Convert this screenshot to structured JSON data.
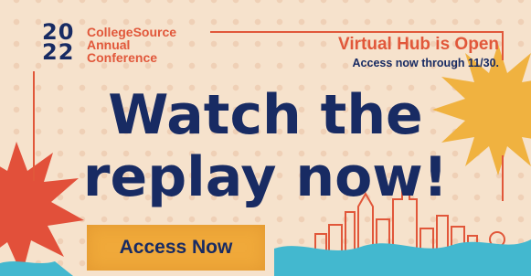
{
  "conference": {
    "year_top": "20",
    "year_bottom": "22",
    "line1": "CollegeSource",
    "line2": "Annual",
    "line3": "Conference"
  },
  "hub": {
    "title": "Virtual Hub is Open",
    "subtitle": "Access now through 11/30."
  },
  "headline": {
    "line1": "Watch the",
    "line2": "replay now!"
  },
  "cta": {
    "label": "Access Now"
  },
  "colors": {
    "background": "#f6e2cc",
    "navy": "#182b63",
    "coral": "#e1573a",
    "sun": "#f0a93a",
    "wave": "#43b8cf"
  }
}
